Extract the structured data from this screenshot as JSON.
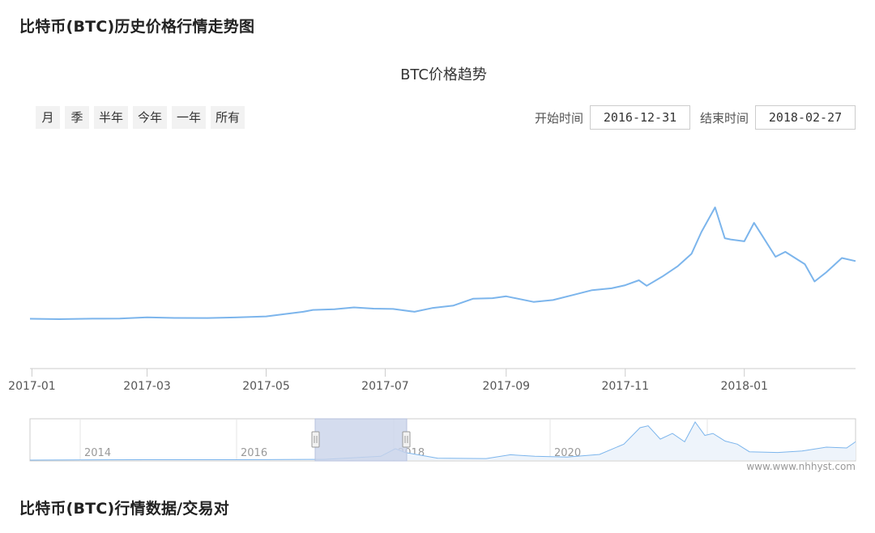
{
  "section_titles": {
    "top": "比特币(BTC)历史价格行情走势图",
    "bottom": "比特币(BTC)行情数据/交易对"
  },
  "range_buttons": [
    "月",
    "季",
    "半年",
    "今年",
    "一年",
    "所有"
  ],
  "date_range": {
    "start_label": "开始时间",
    "start_value": "2016-12-31",
    "end_label": "结束时间",
    "end_value": "2018-02-27"
  },
  "watermark": "www.www.nhhyst.com",
  "colors": {
    "line": "#7cb5ec",
    "navigator_mask": "#c9d3ea",
    "axis": "#cccccc"
  },
  "chart_data": {
    "type": "line",
    "title": "BTC价格趋势",
    "x_tick_labels": [
      "2017-01",
      "2017-03",
      "2017-05",
      "2017-07",
      "2017-09",
      "2017-11",
      "2018-01"
    ],
    "xlabel": "",
    "ylabel": "",
    "grid": false,
    "legend": "none",
    "series": [
      {
        "name": "",
        "x": [
          "2016-12-31",
          "2017-01-15",
          "2017-02-01",
          "2017-02-15",
          "2017-03-01",
          "2017-03-15",
          "2017-04-01",
          "2017-04-15",
          "2017-05-01",
          "2017-05-10",
          "2017-05-20",
          "2017-05-25",
          "2017-06-05",
          "2017-06-15",
          "2017-06-25",
          "2017-07-05",
          "2017-07-16",
          "2017-07-25",
          "2017-08-05",
          "2017-08-15",
          "2017-08-25",
          "2017-09-01",
          "2017-09-15",
          "2017-09-25",
          "2017-10-05",
          "2017-10-15",
          "2017-10-25",
          "2017-11-01",
          "2017-11-08",
          "2017-11-12",
          "2017-11-20",
          "2017-11-28",
          "2017-12-05",
          "2017-12-10",
          "2017-12-17",
          "2017-12-22",
          "2017-12-25",
          "2018-01-01",
          "2018-01-06",
          "2018-01-10",
          "2018-01-17",
          "2018-01-22",
          "2018-02-01",
          "2018-02-06",
          "2018-02-12",
          "2018-02-20",
          "2018-02-27"
        ],
        "values": [
          960,
          900,
          980,
          1000,
          1200,
          1100,
          1080,
          1180,
          1350,
          1700,
          2100,
          2400,
          2500,
          2800,
          2600,
          2550,
          2100,
          2700,
          3100,
          4200,
          4300,
          4600,
          3700,
          4000,
          4800,
          5600,
          5900,
          6400,
          7200,
          6300,
          7800,
          9500,
          11500,
          15000,
          19000,
          14000,
          13800,
          13500,
          16500,
          14500,
          11000,
          11800,
          9800,
          7000,
          8500,
          10800,
          10300
        ]
      }
    ]
  }
}
